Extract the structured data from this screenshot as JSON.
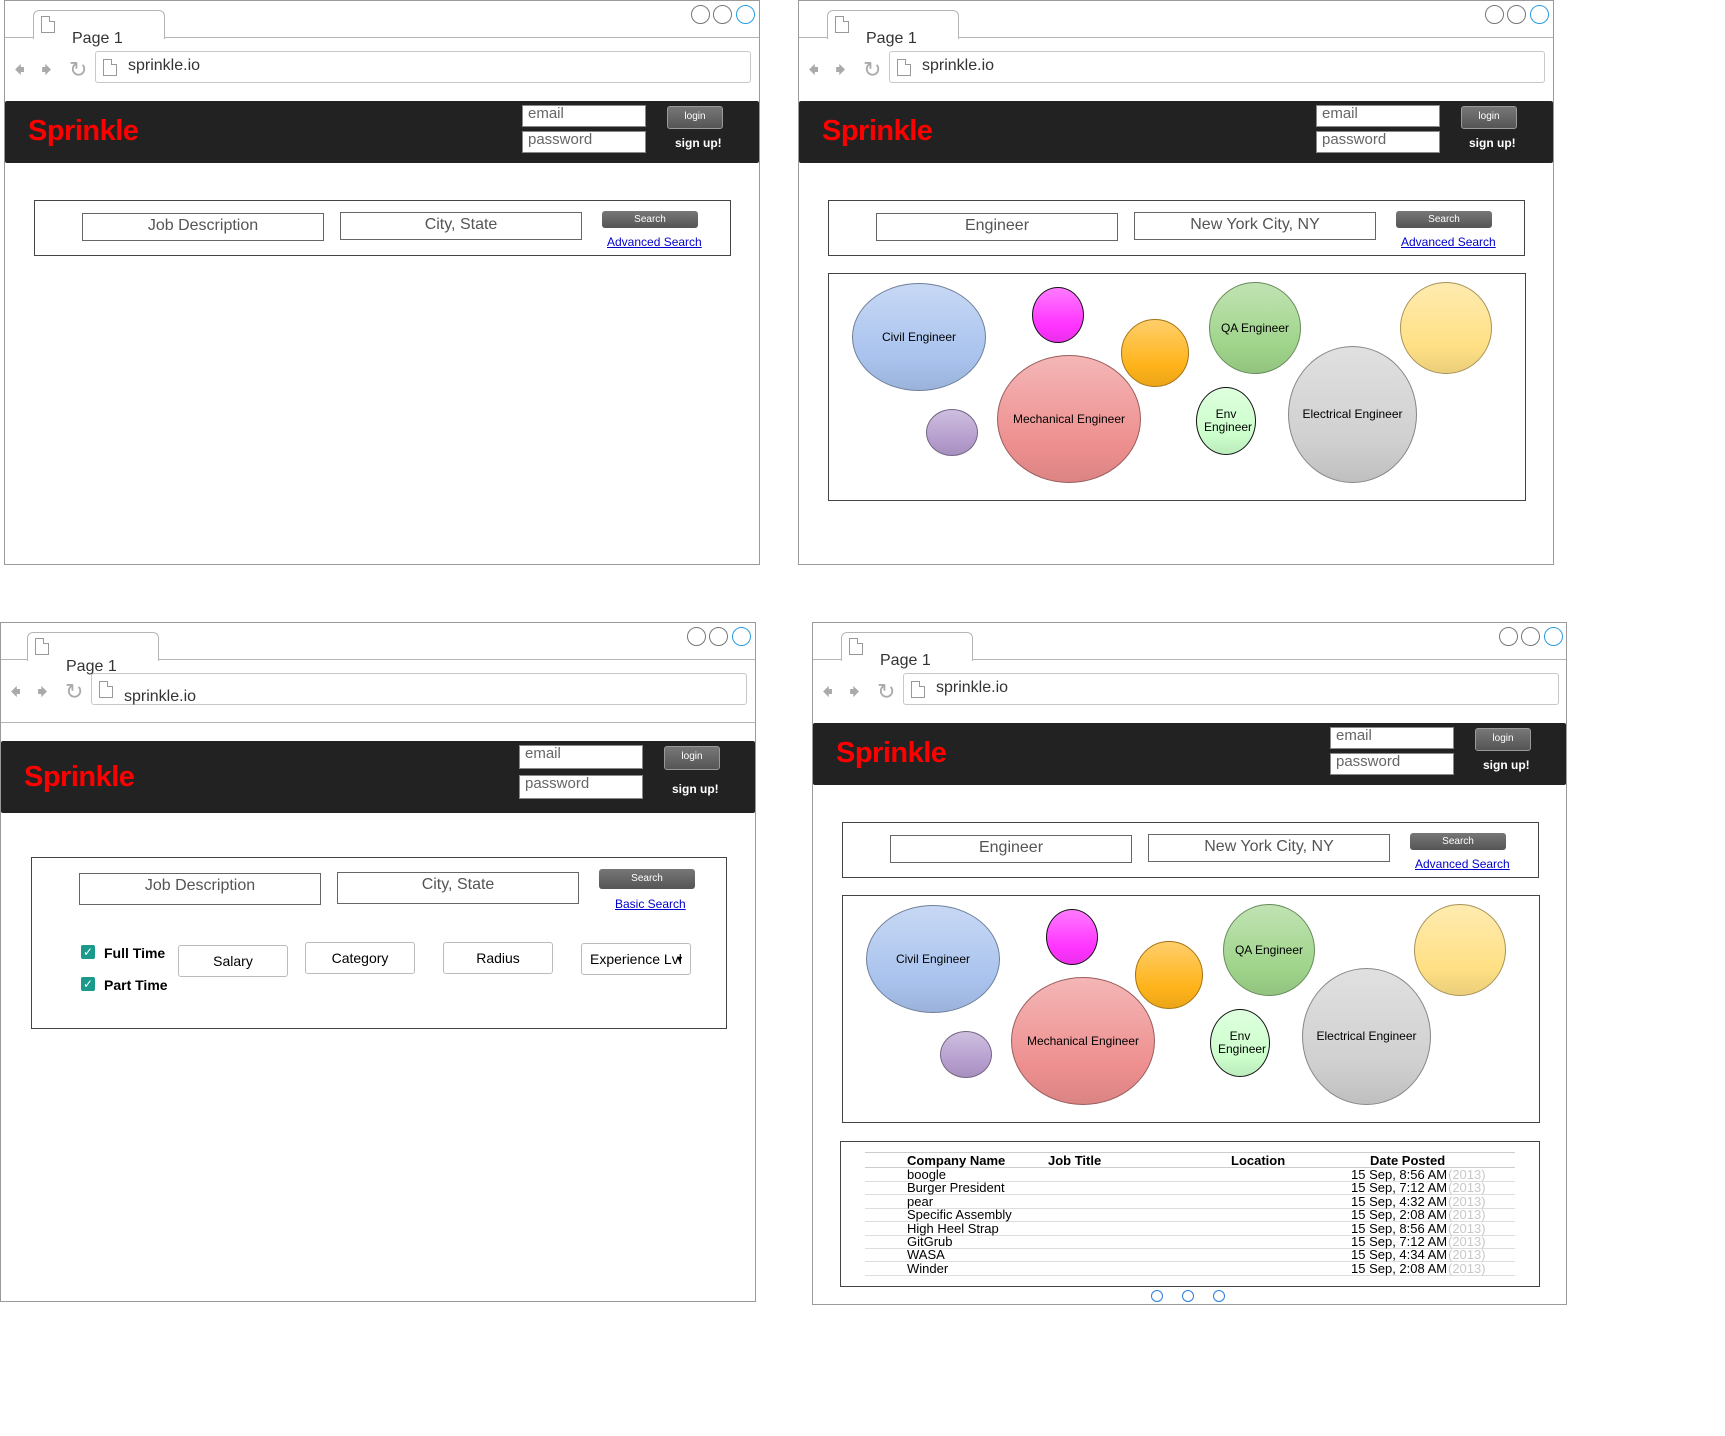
{
  "browser": {
    "tab_label": "Page 1",
    "url": "sprinkle.io"
  },
  "app": {
    "logo": "Sprinkle",
    "email_placeholder": "email",
    "password_placeholder": "password",
    "login_label": "login",
    "signup_label": "sign up!"
  },
  "search": {
    "job_placeholder": "Job Description",
    "location_placeholder": "City, State",
    "job_value": "Engineer",
    "location_value": "New York City, NY",
    "search_label": "Search",
    "advanced_link": "Advanced Search",
    "basic_link": "Basic Search"
  },
  "filters": {
    "full_time": "Full Time",
    "part_time": "Part Time",
    "salary": "Salary",
    "category": "Category",
    "radius": "Radius",
    "experience": "Experience Lvl"
  },
  "bubbles": [
    {
      "label": "Civil Engineer",
      "color": "#a9c3ee"
    },
    {
      "label": "",
      "color": "#ff33ff"
    },
    {
      "label": "",
      "color": "#ffb31a"
    },
    {
      "label": "QA Engineer",
      "color": "#9fd48a"
    },
    {
      "label": "",
      "color": "#ffe085"
    },
    {
      "label": "",
      "color": "#b49ccd"
    },
    {
      "label": "Mechanical Engineer",
      "color": "#ee8f8f"
    },
    {
      "label": "Env Engineer",
      "color": "#ccffcc"
    },
    {
      "label": "Electrical Engineer",
      "color": "#d0d0d0"
    }
  ],
  "table": {
    "headers": [
      "Company Name",
      "Job Title",
      "Location",
      "Date Posted"
    ],
    "rows": [
      {
        "company": "boogle",
        "date": "15 Sep, 8:56 AM",
        "year": "(2013)"
      },
      {
        "company": "Burger President",
        "date": "15 Sep, 7:12 AM",
        "year": "(2013)"
      },
      {
        "company": "pear",
        "date": "15 Sep, 4:32 AM",
        "year": "(2013)"
      },
      {
        "company": "Specific Assembly",
        "date": "15 Sep, 2:08 AM",
        "year": "(2013)"
      },
      {
        "company": "High Heel Strap",
        "date": "15 Sep, 8:56 AM",
        "year": "(2013)"
      },
      {
        "company": "GitGrub",
        "date": "15 Sep, 7:12 AM",
        "year": "(2013)"
      },
      {
        "company": "WASA",
        "date": "15 Sep, 4:34 AM",
        "year": "(2013)"
      },
      {
        "company": "Winder",
        "date": "15 Sep, 2:08 AM",
        "year": "(2013)"
      }
    ]
  }
}
